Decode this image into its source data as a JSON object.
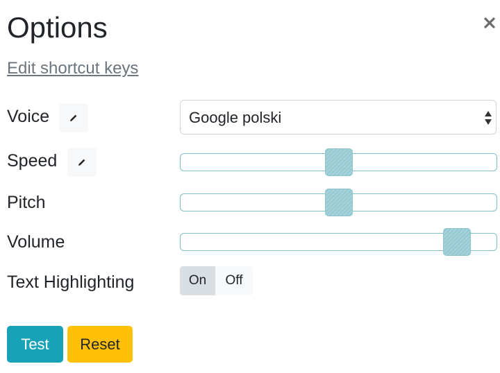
{
  "dialog": {
    "title": "Options",
    "close_icon": "close-icon",
    "edit_shortcut_keys": "Edit shortcut keys"
  },
  "voice": {
    "label": "Voice",
    "edit_icon": "pencil-icon",
    "selected": "Google polski"
  },
  "speed": {
    "label": "Speed",
    "edit_icon": "pencil-icon",
    "value_fraction": 0.5
  },
  "pitch": {
    "label": "Pitch",
    "value_fraction": 0.5
  },
  "volume": {
    "label": "Volume",
    "value_fraction": 0.91
  },
  "highlighting": {
    "label": "Text Highlighting",
    "on_label": "On",
    "off_label": "Off",
    "selected": "On"
  },
  "actions": {
    "test_label": "Test",
    "reset_label": "Reset"
  },
  "colors": {
    "test_button": "#17a2b8",
    "reset_button": "#ffc107",
    "slider_thumb": "#95c9d2",
    "slider_border": "#7fbfca",
    "link": "#6c757d"
  }
}
